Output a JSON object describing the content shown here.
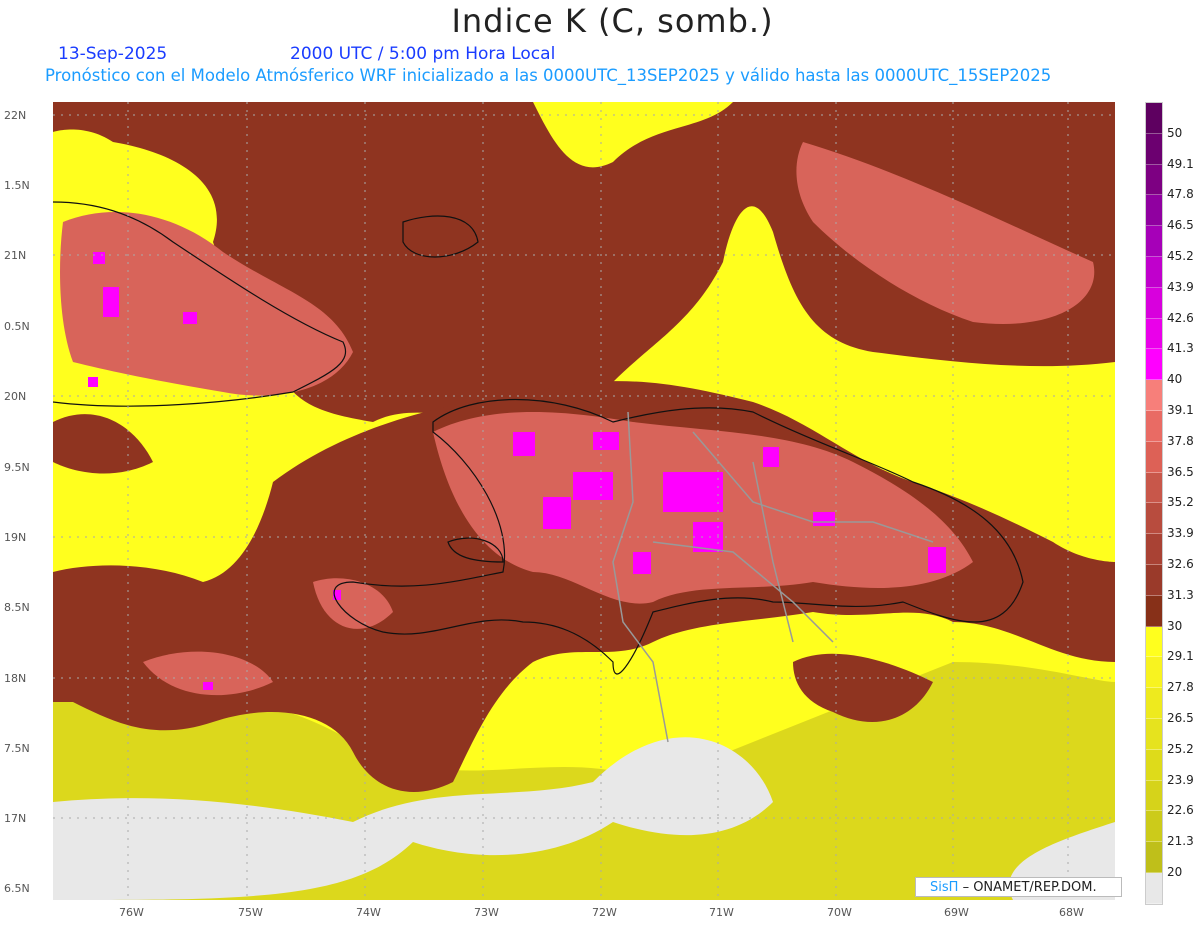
{
  "header": {
    "title": "Indice K (C, somb.)",
    "date": "13-Sep-2025",
    "time": "2000 UTC / 5:00 pm Hora Local",
    "subtitle": "Pronóstico con el Modelo Atmósferico WRF inicializado a las 0000UTC_13SEP2025 y válido hasta las  0000UTC_15SEP2025"
  },
  "axes": {
    "lat_labels": [
      "22N",
      "1.5N",
      "21N",
      "0.5N",
      "20N",
      "9.5N",
      "19N",
      "8.5N",
      "18N",
      "7.5N",
      "17N",
      "6.5N"
    ],
    "lon_labels": [
      "76W",
      "75W",
      "74W",
      "73W",
      "72W",
      "71W",
      "70W",
      "69W",
      "68W"
    ]
  },
  "colorbar": {
    "labels": [
      "50",
      "49.1",
      "47.8",
      "46.5",
      "45.2",
      "43.9",
      "42.6",
      "41.3",
      "40",
      "39.1",
      "37.8",
      "36.5",
      "35.2",
      "33.9",
      "32.6",
      "31.3",
      "30",
      "29.1",
      "27.8",
      "26.5",
      "25.2",
      "23.9",
      "22.6",
      "21.3",
      "20"
    ],
    "colors": [
      "#5e0060",
      "#6c0070",
      "#7d0082",
      "#9000a0",
      "#a600b8",
      "#c000cc",
      "#d800dd",
      "#ea00ea",
      "#ff00ff",
      "#f77f7a",
      "#e96b64",
      "#dd6156",
      "#c8574a",
      "#b84c3e",
      "#a94234",
      "#9a3a2a",
      "#873018",
      "#ffff1e",
      "#f8f320",
      "#eeea1e",
      "#e6e31e",
      "#dedb1a",
      "#d6d31a",
      "#cccb1a",
      "#bfbf1a",
      "#e8e8e8"
    ]
  },
  "credit": {
    "logo": "SisΠ",
    "text": "– ONAMET/REP.DOM."
  }
}
